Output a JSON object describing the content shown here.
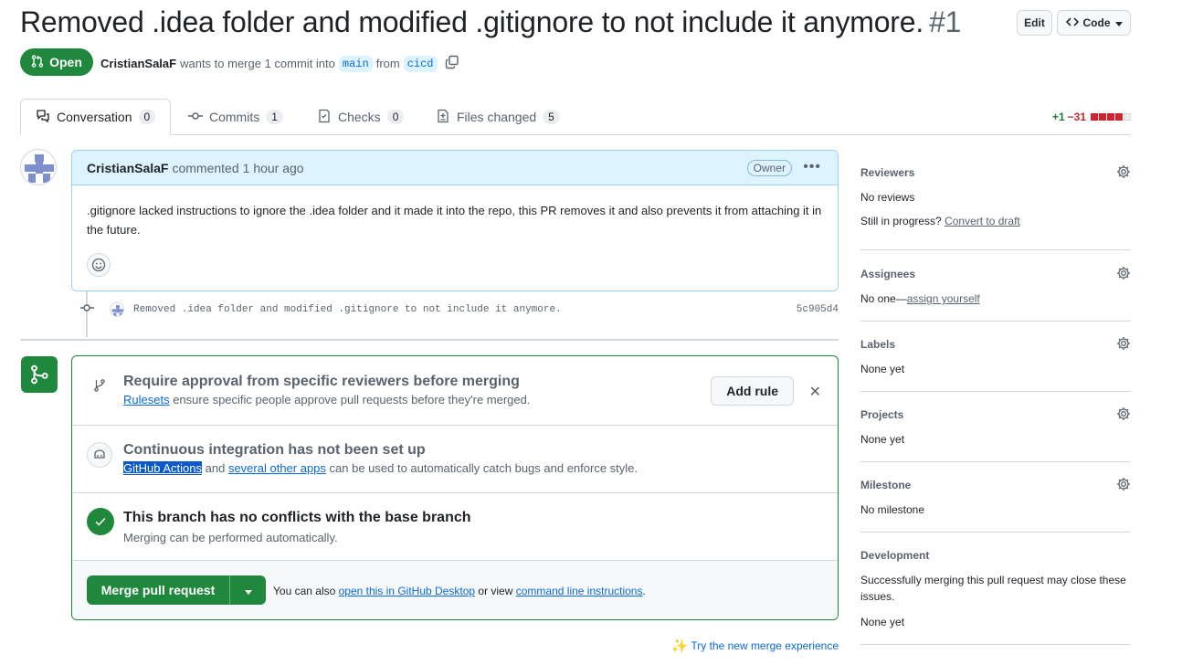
{
  "pr": {
    "title": "Removed .idea folder and modified .gitignore to not include it anymore.",
    "number": "#1",
    "state": "Open",
    "author": "CristianSalaF",
    "meta_text": "wants to merge 1 commit into",
    "base_branch": "main",
    "from_text": "from",
    "head_branch": "cicd",
    "edit_label": "Edit",
    "code_label": "Code"
  },
  "tabs": [
    {
      "label": "Conversation",
      "count": "0"
    },
    {
      "label": "Commits",
      "count": "1"
    },
    {
      "label": "Checks",
      "count": "0"
    },
    {
      "label": "Files changed",
      "count": "5"
    }
  ],
  "diffstat": {
    "added": "+1",
    "removed": "−31"
  },
  "comment": {
    "author": "CristianSalaF",
    "action": "commented",
    "time": "1 hour ago",
    "badge": "Owner",
    "body": ".gitignore lacked instructions to ignore the .idea folder and it made it into the repo, this PR removes it and also prevents it from attaching it in the future."
  },
  "commit": {
    "message": "Removed .idea folder and modified .gitignore to not include it anymore.",
    "sha": "5c905d4"
  },
  "merge": {
    "rules": {
      "title": "Require approval from specific reviewers before merging",
      "link": "Rulesets",
      "text": "ensure specific people approve pull requests before they're merged.",
      "button": "Add rule"
    },
    "ci": {
      "title": "Continuous integration has not been set up",
      "link1": "GitHub Actions",
      "and": "and",
      "link2": "several other apps",
      "text": "can be used to automatically catch bugs and enforce style."
    },
    "conflicts": {
      "title": "This branch has no conflicts with the base branch",
      "text": "Merging can be performed automatically."
    },
    "button": "Merge pull request",
    "also": "You can also",
    "desktop_link": "open this in GitHub Desktop",
    "or_view": "or view",
    "cli_link": "command line instructions",
    "period": ".",
    "try_new": "Try the new merge experience"
  },
  "sidebar": {
    "reviewers": {
      "heading": "Reviewers",
      "value": "No reviews",
      "progress": "Still in progress?",
      "draft_link": "Convert to draft"
    },
    "assignees": {
      "heading": "Assignees",
      "value": "No one—",
      "link": "assign yourself"
    },
    "labels": {
      "heading": "Labels",
      "value": "None yet"
    },
    "projects": {
      "heading": "Projects",
      "value": "None yet"
    },
    "milestone": {
      "heading": "Milestone",
      "value": "No milestone"
    },
    "development": {
      "heading": "Development",
      "text": "Successfully merging this pull request may close these issues.",
      "value": "None yet"
    }
  },
  "colors": {
    "accent": "#0969da",
    "success": "#1f883d",
    "danger": "#d1242f"
  }
}
